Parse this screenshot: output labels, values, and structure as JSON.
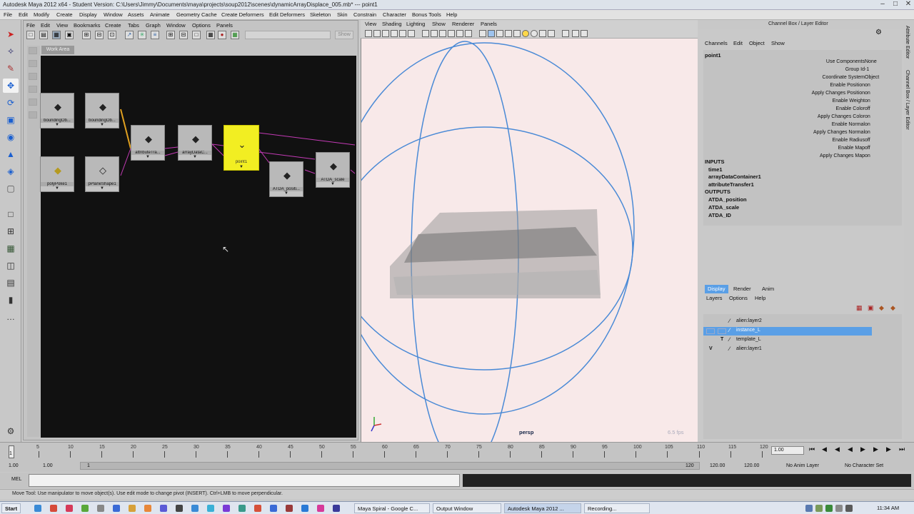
{
  "window": {
    "title": "Autodesk Maya 2012 x64 - Student Version: C:\\Users\\Jimmy\\Documents\\maya\\projects\\soup2012\\scenes\\dynamicArrayDisplace_005.mb*  ---  point1"
  },
  "menubar": [
    "File",
    "Edit",
    "Modify",
    "Create",
    "Display",
    "Window",
    "Assets",
    "Animate",
    "Geometry Cache",
    "Create Deformers",
    "Edit Deformers",
    "Skeleton",
    "Skin",
    "Constrain",
    "Character",
    "Bonus Tools",
    "Help"
  ],
  "hypergraph": {
    "menu": [
      "File",
      "Edit",
      "View",
      "Bookmarks",
      "Create",
      "Tabs",
      "Graph",
      "Window",
      "Options",
      "Panels"
    ],
    "show_button": "Show",
    "work_area_tab": "Work Area",
    "nodes": [
      {
        "label": "boundingOb..."
      },
      {
        "label": "boundingOb..."
      },
      {
        "label": "polyPoke1"
      },
      {
        "label": "pPlaneShape1"
      },
      {
        "label": "attributeTra..."
      },
      {
        "label": "arrayDataC..."
      },
      {
        "label": "point1"
      },
      {
        "label": "ATDA_positi..."
      },
      {
        "label": "ATDA_scale"
      }
    ]
  },
  "viewport": {
    "menu": [
      "View",
      "Shading",
      "Lighting",
      "Show",
      "Renderer",
      "Panels"
    ],
    "camera_label": "persp",
    "fps": "6.5 fps",
    "colors": {
      "background": "#f8e9e9",
      "sphere": "#4a8ad6"
    }
  },
  "channel_box": {
    "header": "Channel Box / Layer Editor",
    "menu": [
      "Channels",
      "Edit",
      "Object",
      "Show"
    ],
    "node": "point1",
    "attributes": [
      {
        "name": "Use Components",
        "value": "None"
      },
      {
        "name": "Group Id",
        "value": "-1"
      },
      {
        "name": "Coordinate System",
        "value": "Object"
      },
      {
        "name": "Enable Position",
        "value": "on"
      },
      {
        "name": "Apply Changes Position",
        "value": "on"
      },
      {
        "name": "Enable Weight",
        "value": "on"
      },
      {
        "name": "Enable Color",
        "value": "off"
      },
      {
        "name": "Apply Changes Color",
        "value": "on"
      },
      {
        "name": "Enable Normal",
        "value": "on"
      },
      {
        "name": "Apply Changes Normal",
        "value": "on"
      },
      {
        "name": "Enable Radius",
        "value": "off"
      },
      {
        "name": "Enable Map",
        "value": "off"
      },
      {
        "name": "Apply Changes Map",
        "value": "on"
      }
    ],
    "inputs_label": "INPUTS",
    "inputs": [
      "time1",
      "arrayDataContainer1",
      "attributeTransfer1"
    ],
    "outputs_label": "OUTPUTS",
    "outputs": [
      "ATDA_position",
      "ATDA_scale",
      "ATDA_ID"
    ]
  },
  "side_tabs": [
    "Attribute Editor",
    "Channel Box / Layer Editor"
  ],
  "layer_editor": {
    "tabs": [
      "Display",
      "Render",
      "Anim"
    ],
    "menu": [
      "Layers",
      "Options",
      "Help"
    ],
    "layers": [
      {
        "v": "",
        "p": "",
        "name": "alien:layer2",
        "selected": false
      },
      {
        "v": "",
        "p": "",
        "name": "instance_L",
        "selected": true
      },
      {
        "v": "",
        "p": "T",
        "name": "template_L",
        "selected": false
      },
      {
        "v": "V",
        "p": "",
        "name": "alien:layer1",
        "selected": false
      }
    ],
    "selected_color": "#5a9fe6"
  },
  "timeline": {
    "ticks": [
      "5",
      "10",
      "15",
      "20",
      "25",
      "30",
      "35",
      "40",
      "45",
      "50",
      "55",
      "60",
      "65",
      "70",
      "75",
      "80",
      "85",
      "90",
      "95",
      "100",
      "105",
      "110",
      "115",
      "120"
    ],
    "current_frame_marker": "1",
    "current_frame_field": "1.00"
  },
  "range": {
    "start": "1.00",
    "playback_start": "1.00",
    "range_start_label": "1",
    "range_end_label": "120",
    "playback_end": "120.00",
    "end": "120.00",
    "anim_layer": "No Anim Layer",
    "character_set": "No Character Set"
  },
  "command_line": {
    "label": "MEL"
  },
  "help_line": "Move Tool: Use manipulator to move object(s). Use edit mode to change pivot (INSERT).  Ctrl+LMB to move perpendicular.",
  "taskbar": {
    "start": "Start",
    "items": [
      "Maya Spiral - Google C...",
      "Output Window",
      "Autodesk Maya 2012 ...",
      "Recording..."
    ],
    "clock": "11:34 AM"
  }
}
